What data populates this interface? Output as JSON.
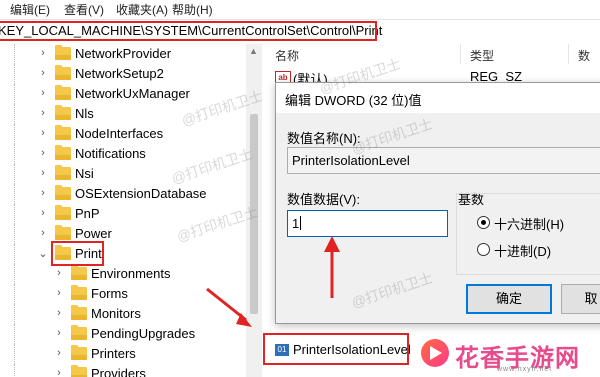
{
  "menubar": {
    "items": [
      "编辑(E)",
      "查看(V)",
      "收藏夹(A)",
      "帮助(H)"
    ]
  },
  "address": {
    "path": "KEY_LOCAL_MACHINE\\SYSTEM\\CurrentControlSet\\Control\\Print"
  },
  "tree": {
    "items": [
      {
        "label": "NetworkProvider",
        "expanded": false
      },
      {
        "label": "NetworkSetup2",
        "expanded": false
      },
      {
        "label": "NetworkUxManager",
        "expanded": false
      },
      {
        "label": "Nls",
        "expanded": false
      },
      {
        "label": "NodeInterfaces",
        "expanded": false
      },
      {
        "label": "Notifications",
        "expanded": false
      },
      {
        "label": "Nsi",
        "expanded": false
      },
      {
        "label": "OSExtensionDatabase",
        "expanded": false
      },
      {
        "label": "PnP",
        "expanded": false
      },
      {
        "label": "Power",
        "expanded": false
      },
      {
        "label": "Print",
        "expanded": true
      },
      {
        "label": "Environments",
        "expanded": false
      },
      {
        "label": "Forms",
        "expanded": false
      },
      {
        "label": "Monitors",
        "expanded": false
      },
      {
        "label": "PendingUpgrades",
        "expanded": false
      },
      {
        "label": "Printers",
        "expanded": false
      },
      {
        "label": "Providers",
        "expanded": false
      }
    ]
  },
  "list": {
    "columns": {
      "name": "名称",
      "type": "类型",
      "data": "数"
    },
    "rows": [
      {
        "icon": "ab-icon",
        "name": "(默认)",
        "type": "REG_SZ"
      },
      {
        "icon": "binary-icon",
        "name": "PrinterIsolationLevel",
        "type": ""
      }
    ]
  },
  "dialog": {
    "title": "编辑 DWORD (32 位)值",
    "value_name_label": "数值名称(N):",
    "value_name": "PrinterIsolationLevel",
    "value_data_label": "数值数据(V):",
    "value_data": "1",
    "base_label": "基数",
    "hex_label": "十六进制(H)",
    "dec_label": "十进制(D)",
    "selected_base": "hex",
    "ok_label": "确定",
    "cancel_label": "取"
  },
  "watermark": "@打印机卫士",
  "logo": {
    "text": "花香手游网",
    "sub": "www.hxyh.net"
  },
  "colors": {
    "highlight": "#e02424",
    "folder": "#f5c84c",
    "accent": "#0078d7"
  }
}
